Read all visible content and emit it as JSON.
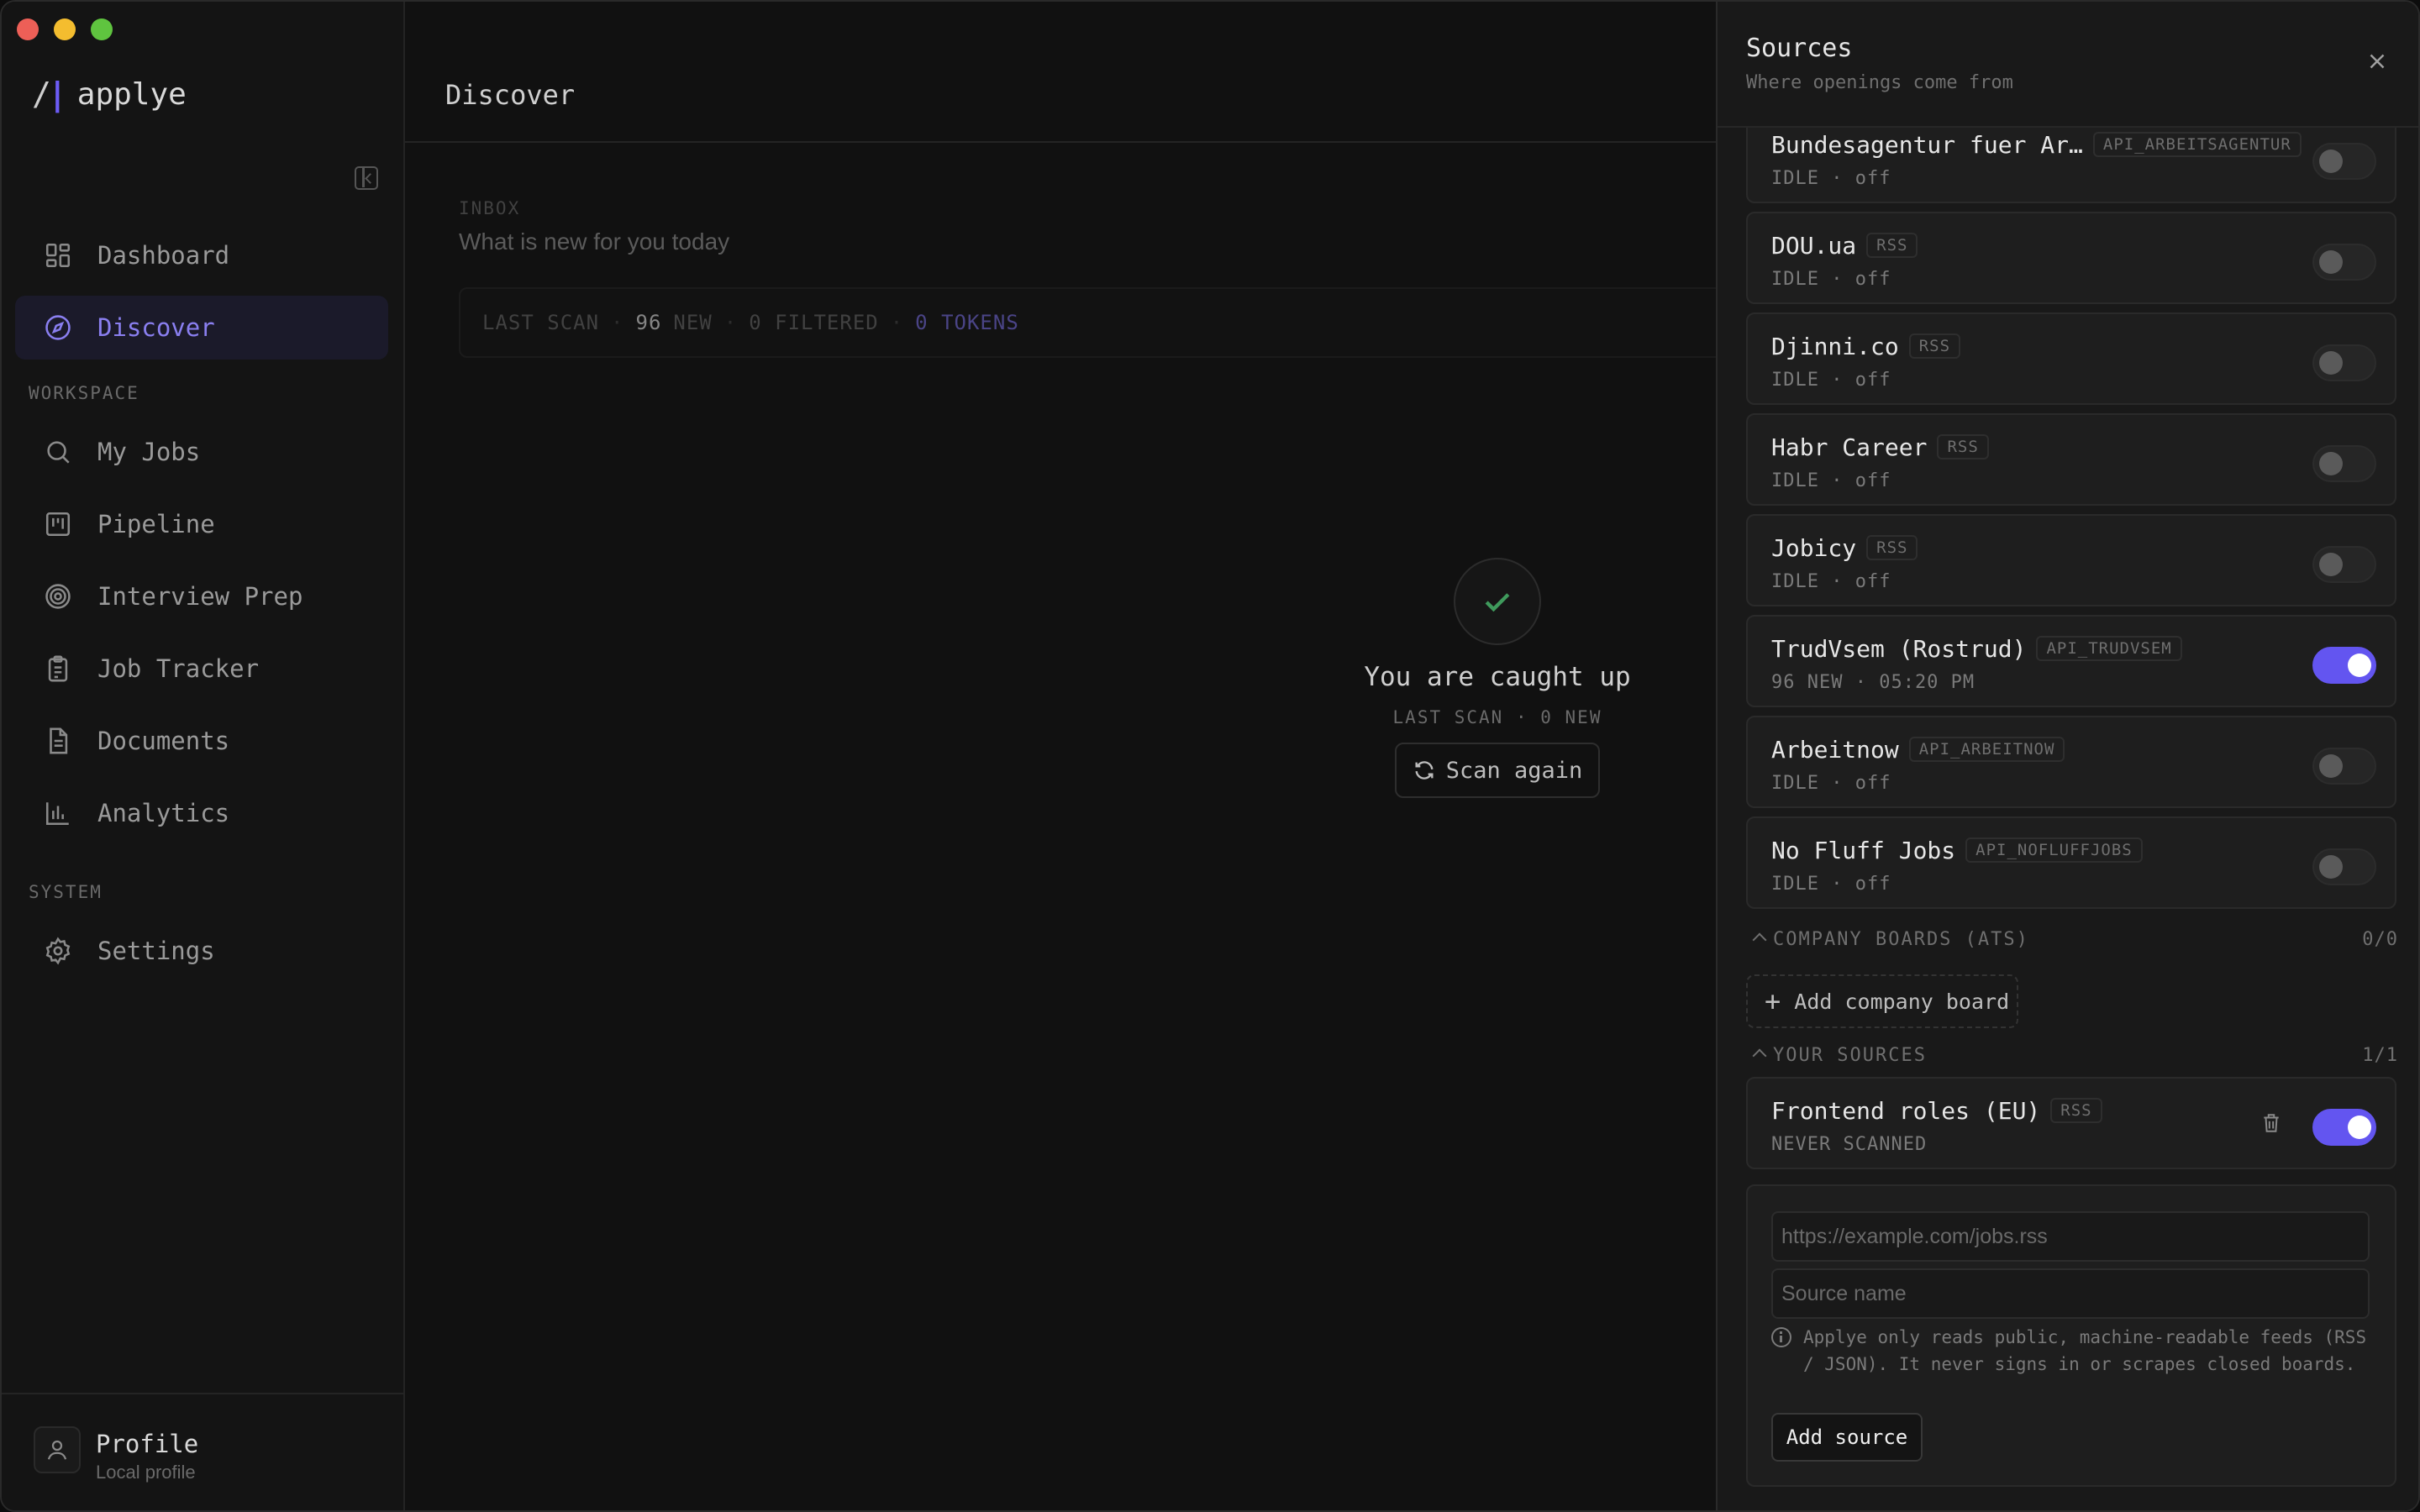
{
  "app": {
    "brand_mark": "/",
    "name": "applye"
  },
  "sidebar": {
    "nav_top": [
      {
        "label": "Dashboard",
        "icon": "dashboard-icon",
        "active": false
      },
      {
        "label": "Discover",
        "icon": "compass-icon",
        "active": true
      }
    ],
    "workspace_label": "WORKSPACE",
    "workspace": [
      {
        "label": "My Jobs",
        "icon": "search-icon"
      },
      {
        "label": "Pipeline",
        "icon": "kanban-icon"
      },
      {
        "label": "Interview Prep",
        "icon": "target-icon"
      },
      {
        "label": "Job Tracker",
        "icon": "clipboard-icon"
      },
      {
        "label": "Documents",
        "icon": "document-icon"
      },
      {
        "label": "Analytics",
        "icon": "bar-chart-icon"
      }
    ],
    "system_label": "SYSTEM",
    "system": [
      {
        "label": "Settings",
        "icon": "gear-icon"
      }
    ],
    "profile": {
      "name": "Profile",
      "sub": "Local profile"
    }
  },
  "main": {
    "title": "Discover",
    "inbox_label": "INBOX",
    "inbox_title": "What is new for you today",
    "scanbar": {
      "last_scan": "LAST SCAN",
      "count": "96",
      "new": "NEW",
      "filtered": "0 FILTERED",
      "tokens": "0 TOKENS"
    },
    "empty": {
      "title": "You are caught up",
      "sub": "LAST SCAN · 0 NEW",
      "button": "Scan again"
    }
  },
  "panel": {
    "title": "Sources",
    "subtitle": "Where openings come from",
    "sources": [
      {
        "name": "Bundesagentur fuer Ar…",
        "tag": "API_ARBEITSAGENTUR",
        "status": "IDLE · off",
        "on": false
      },
      {
        "name": "DOU.ua",
        "tag": "RSS",
        "status": "IDLE · off",
        "on": false
      },
      {
        "name": "Djinni.co",
        "tag": "RSS",
        "status": "IDLE · off",
        "on": false
      },
      {
        "name": "Habr Career",
        "tag": "RSS",
        "status": "IDLE · off",
        "on": false
      },
      {
        "name": "Jobicy",
        "tag": "RSS",
        "status": "IDLE · off",
        "on": false
      },
      {
        "name": "TrudVsem (Rostrud)",
        "tag": "API_TRUDVSEM",
        "status": "96 NEW · 05:20 PM",
        "on": true
      },
      {
        "name": "Arbeitnow",
        "tag": "API_ARBEITNOW",
        "status": "IDLE · off",
        "on": false
      },
      {
        "name": "No Fluff Jobs",
        "tag": "API_NOFLUFFJOBS",
        "status": "IDLE · off",
        "on": false
      }
    ],
    "company_boards": {
      "label": "COMPANY BOARDS (ATS)",
      "count": "0/0",
      "add_label": "Add company board"
    },
    "your_sources": {
      "label": "YOUR SOURCES",
      "count": "1/1",
      "items": [
        {
          "name": "Frontend roles (EU)",
          "tag": "RSS",
          "status": "NEVER SCANNED",
          "on": true
        }
      ]
    },
    "form": {
      "url_placeholder": "https://example.com/jobs.rss",
      "name_placeholder": "Source name",
      "info": "Applye only reads public, machine-readable feeds (RSS / JSON). It never signs in or scrapes closed boards.",
      "submit": "Add source"
    }
  },
  "colors": {
    "accent": "#6355f0",
    "success": "#3f9a5c"
  }
}
